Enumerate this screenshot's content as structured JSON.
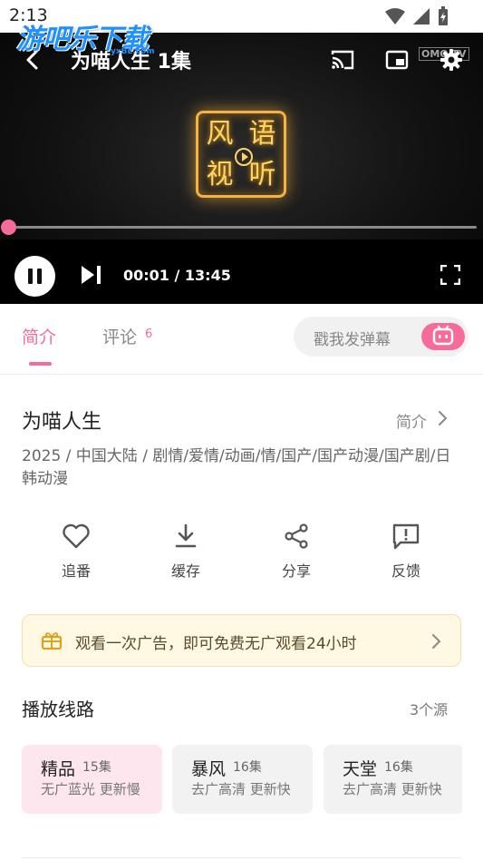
{
  "status_bar": {
    "time": "2:13",
    "icons": [
      "wifi-icon",
      "signal-icon",
      "battery-icon"
    ]
  },
  "watermark": {
    "text": "游吧乐下载",
    "sub": "yxBL.com"
  },
  "player": {
    "title": "为喵人生 1集",
    "brand_tag": "OMO TV",
    "seal_chars": [
      "风",
      "语",
      "视",
      "听"
    ],
    "time": "00:01 / 13:45",
    "progress": 0.001,
    "state": "playing",
    "accent": "#f56c9a"
  },
  "tabs": {
    "intro": "简介",
    "comments": "评论",
    "comment_count": "6",
    "danmaku_placeholder": "戳我发弹幕"
  },
  "show": {
    "title": "为喵人生",
    "intro_link": "简介",
    "meta": "2025 / 中国大陆 / 剧情/爱情/动画/情/国产/国产动漫/国产剧/日韩动漫"
  },
  "actions": [
    {
      "label": "追番",
      "icon": "heart-icon"
    },
    {
      "label": "缓存",
      "icon": "download-icon"
    },
    {
      "label": "分享",
      "icon": "share-icon"
    },
    {
      "label": "反馈",
      "icon": "feedback-icon"
    }
  ],
  "ad_banner": {
    "text": "观看一次广告，即可免费无广观看24小时",
    "icon": "gift-icon"
  },
  "routes": {
    "title": "播放线路",
    "count": "3个源",
    "sources": [
      {
        "name": "精品",
        "episodes": "15集",
        "desc": "无广蓝光 更新慢",
        "active": true
      },
      {
        "name": "暴风",
        "episodes": "16集",
        "desc": "去广高清 更新快",
        "active": false
      },
      {
        "name": "天堂",
        "episodes": "16集",
        "desc": "去广高清 更新快",
        "active": false
      }
    ]
  }
}
